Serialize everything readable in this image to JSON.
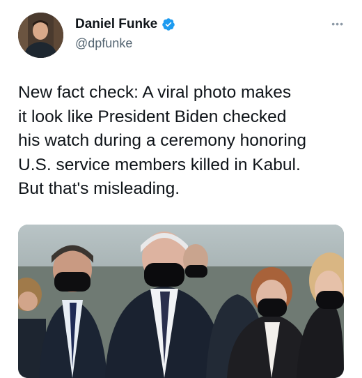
{
  "tweet": {
    "author": {
      "display_name": "Daniel Funke",
      "handle": "@dpfunke",
      "verified": true,
      "avatar_icon": "profile-photo"
    },
    "more_icon": "more-dots-icon",
    "text": "New fact check: A viral photo makes\nit look like President Biden checked\nhis watch during a ceremony honoring\nU.S. service members killed in Kabul.\nBut that's misleading.",
    "media": {
      "type": "photo",
      "icon": "photo-image"
    }
  },
  "colors": {
    "verified_badge": "#1d9bf0",
    "handle_text": "#536471",
    "primary_text": "#0f1419"
  }
}
